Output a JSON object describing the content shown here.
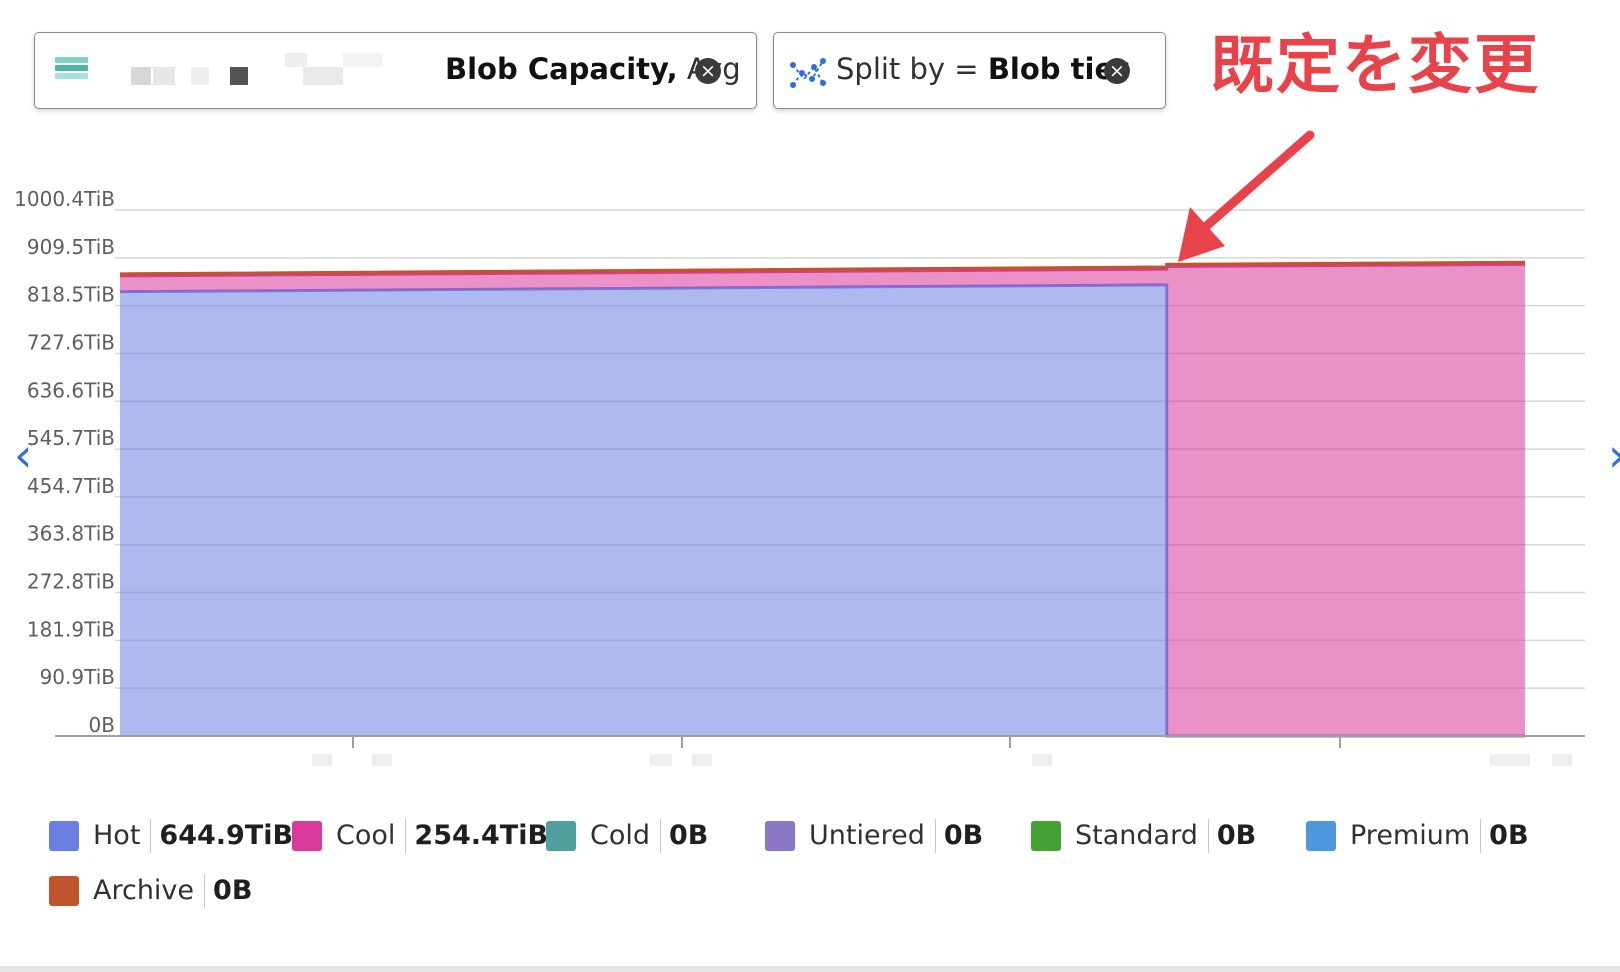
{
  "metric_pill": {
    "metric": "Blob Capacity,",
    "aggregation": "Avg",
    "close_icon": "close-circle-icon"
  },
  "split_pill": {
    "label": "Split by =",
    "value": "Blob tier",
    "icon": "split-scatter-icon",
    "close_icon": "close-circle-icon"
  },
  "annotation": {
    "text": "既定を変更",
    "color": "#e8434a"
  },
  "nav": {
    "prev_icon": "chevron-left-icon",
    "next_icon": "chevron-right-icon"
  },
  "chart_data": {
    "type": "area",
    "stacked": true,
    "title": "",
    "xlabel": "",
    "ylabel": "",
    "ylim": [
      0,
      1000.4
    ],
    "y_unit": "TiB",
    "y_ticks": [
      "0B",
      "90.9TiB",
      "181.9TiB",
      "272.8TiB",
      "363.8TiB",
      "454.7TiB",
      "545.7TiB",
      "636.6TiB",
      "727.6TiB",
      "818.5TiB",
      "909.5TiB",
      "1000.4TiB"
    ],
    "x_ticks_hidden": true,
    "grid": true,
    "legend_position": "bottom",
    "x": [
      0,
      0.745,
      0.745,
      1
    ],
    "series": [
      {
        "name": "Hot",
        "color": "#6b7fe3",
        "values": [
          845,
          858,
          0,
          0
        ]
      },
      {
        "name": "Cool",
        "color": "#d9399a",
        "values": [
          30,
          30,
          893,
          897
        ]
      },
      {
        "name": "Archive",
        "color": "#c0542a",
        "values": [
          4,
          4,
          4,
          4
        ]
      }
    ]
  },
  "legend": [
    {
      "name": "Hot",
      "value": "644.9TiB",
      "color": "#6b7fe3"
    },
    {
      "name": "Cool",
      "value": "254.4TiB",
      "color": "#d9399a"
    },
    {
      "name": "Cold",
      "value": "0B",
      "color": "#4e9f9e"
    },
    {
      "name": "Untiered",
      "value": "0B",
      "color": "#8b76c5"
    },
    {
      "name": "Standard",
      "value": "0B",
      "color": "#44a235"
    },
    {
      "name": "Premium",
      "value": "0B",
      "color": "#4f97dc"
    },
    {
      "name": "Archive",
      "value": "0B",
      "color": "#c0542a"
    }
  ]
}
